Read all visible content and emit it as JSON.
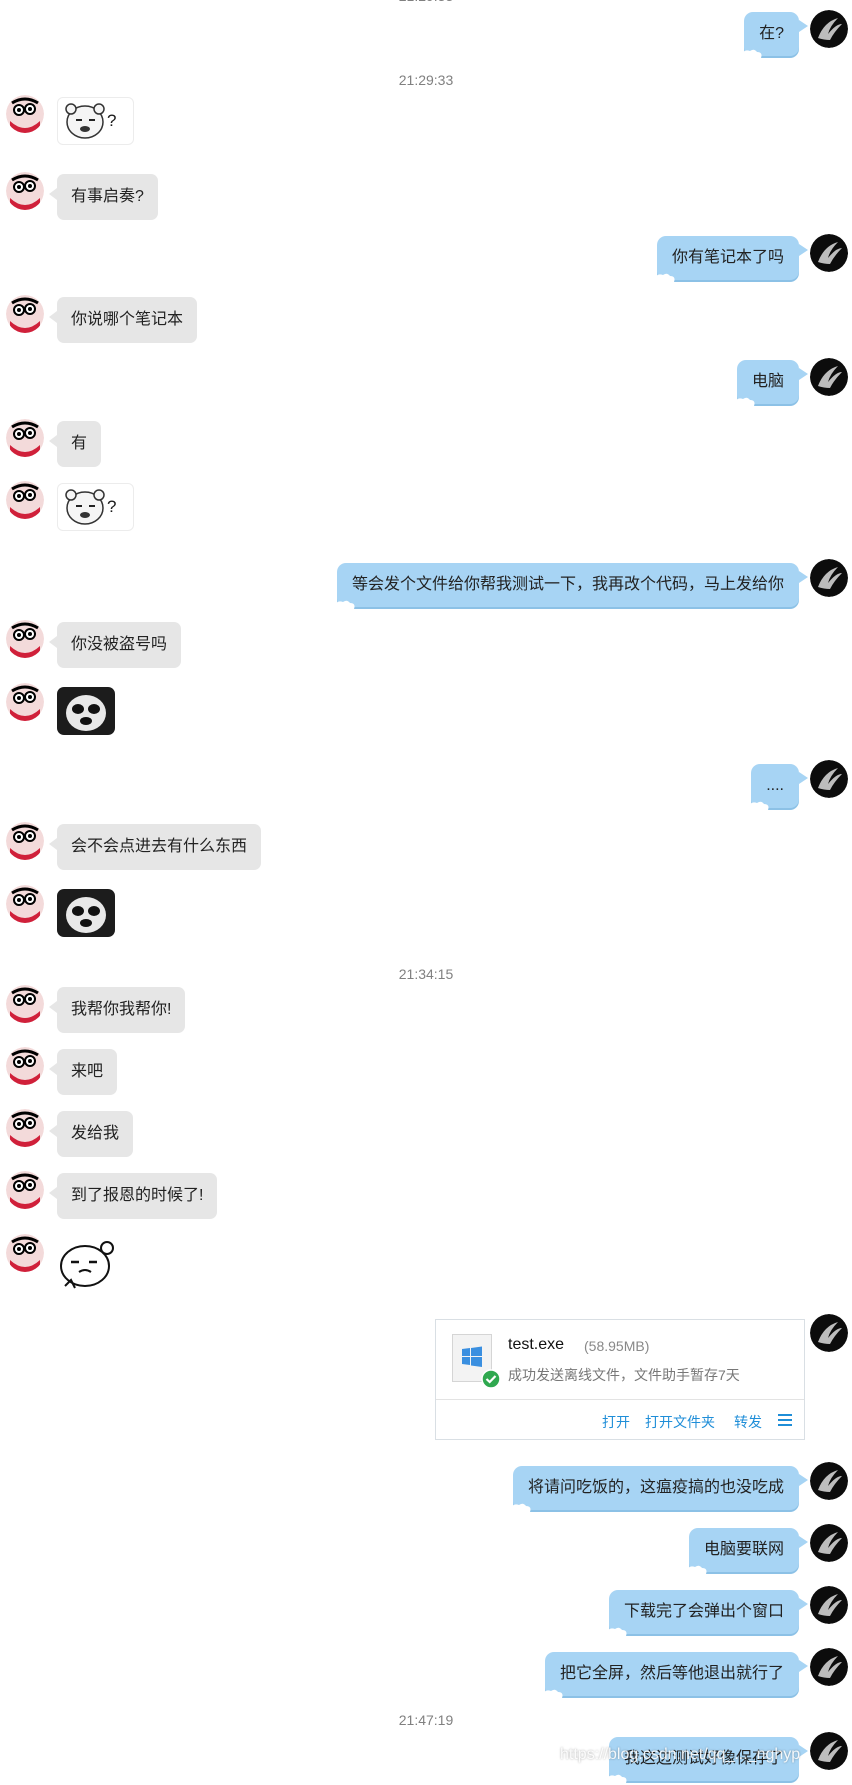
{
  "messages": {
    "m0": {
      "text": "在?"
    },
    "m1": {
      "text": "?"
    },
    "m2": {
      "text": "有事启奏?"
    },
    "m3": {
      "text": "你有笔记本了吗"
    },
    "m4": {
      "text": "你说哪个笔记本"
    },
    "m5": {
      "text": "电脑"
    },
    "m6": {
      "text": "有"
    },
    "m7": {
      "text": "?"
    },
    "m8": {
      "text": "等会发个文件给你帮我测试一下，我再改个代码，马上发给你"
    },
    "m9": {
      "text": "你没被盗号吗"
    },
    "m11": {
      "text": "...."
    },
    "m12": {
      "text": "会不会点进去有什么东西"
    },
    "m14": {
      "text": "我帮你我帮你!"
    },
    "m15": {
      "text": "来吧"
    },
    "m16": {
      "text": "发给我"
    },
    "m17": {
      "text": "到了报恩的时候了!"
    },
    "m19": {
      "text": "将请问吃饭的，这瘟疫搞的也没吃成"
    },
    "m20": {
      "text": "电脑要联网"
    },
    "m21": {
      "text": "下载完了会弹出个窗口"
    },
    "m22": {
      "text": "把它全屏，然后等他退出就行了"
    },
    "m23": {
      "text": "我这边测试好像保存了"
    }
  },
  "timestamps": {
    "t1": "21:29:33",
    "t2": "21:34:15",
    "t3": "21:47:19"
  },
  "file": {
    "name": "test.exe",
    "size": "(58.95MB)",
    "status": "成功发送离线文件，文件助手暂存7天",
    "actions": {
      "open": "打开",
      "open_folder": "打开文件夹",
      "forward": "转发"
    }
  },
  "watermark": "https://blog.csdn.net/qq_..._nghyp",
  "colors": {
    "self_bubble": "#a7d4f4",
    "other_bubble": "#e6e6e6",
    "link": "#1f8ed8",
    "timestamp": "#808080"
  }
}
